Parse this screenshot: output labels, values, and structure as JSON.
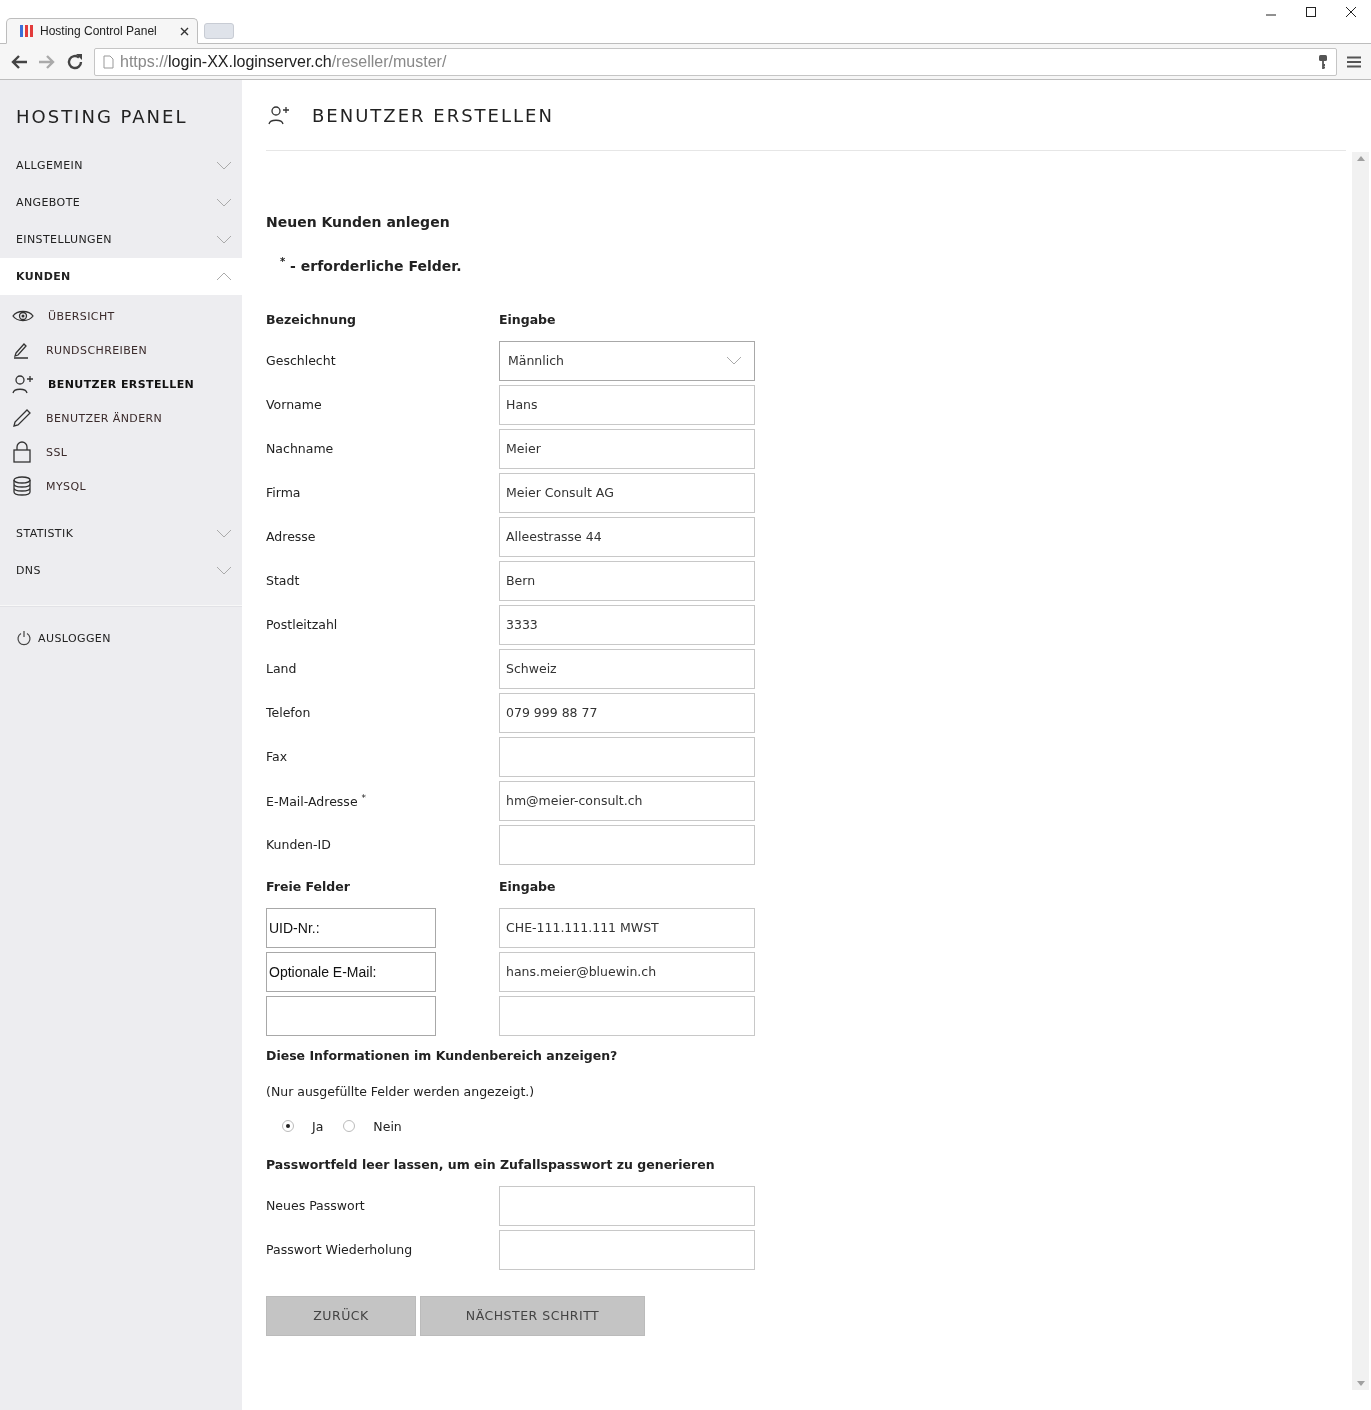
{
  "browser": {
    "tab_title": "Hosting Control Panel",
    "url": {
      "scheme": "https://",
      "host": "login-XX.loginserver.ch",
      "path": "/reseller/muster/"
    }
  },
  "sidebar": {
    "title": "HOSTING PANEL",
    "sections": [
      {
        "label": "ALLGEMEIN",
        "expanded": false
      },
      {
        "label": "ANGEBOTE",
        "expanded": false
      },
      {
        "label": "EINSTELLUNGEN",
        "expanded": false
      },
      {
        "label": "KUNDEN",
        "expanded": true,
        "children": [
          {
            "label": "ÜBERSICHT",
            "selected": false
          },
          {
            "label": "RUNDSCHREIBEN",
            "selected": false
          },
          {
            "label": "BENUTZER ERSTELLEN",
            "selected": true
          },
          {
            "label": "BENUTZER ÄNDERN",
            "selected": false
          },
          {
            "label": "SSL",
            "selected": false
          },
          {
            "label": "MYSQL",
            "selected": false
          }
        ]
      },
      {
        "label": "STATISTIK",
        "expanded": false
      },
      {
        "label": "DNS",
        "expanded": false
      }
    ],
    "logout": "AUSLOGGEN"
  },
  "page": {
    "title": "BENUTZER ERSTELLEN"
  },
  "form": {
    "heading": "Neuen Kunden anlegen",
    "required_note": "$^{*}$ - erforderliche Felder.",
    "columns": [
      "Bezeichnung",
      "Eingabe"
    ],
    "fields": [
      {
        "label": "Geschlecht",
        "value": "Männlich",
        "kind": "select"
      },
      {
        "label": "Vorname",
        "value": "Hans",
        "kind": "text"
      },
      {
        "label": "Nachname",
        "value": "Meier",
        "kind": "text"
      },
      {
        "label": "Firma",
        "value": "Meier Consult AG",
        "kind": "text"
      },
      {
        "label": "Adresse",
        "value": "Alleestrasse 44",
        "kind": "text"
      },
      {
        "label": "Stadt",
        "value": "Bern",
        "kind": "text"
      },
      {
        "label": "Postleitzahl",
        "value": "3333",
        "kind": "text"
      },
      {
        "label": "Land",
        "value": "Schweiz",
        "kind": "text"
      },
      {
        "label": "Telefon",
        "value": "079 999 88 77",
        "kind": "text"
      },
      {
        "label": "Fax",
        "kind": "text"
      },
      {
        "label": "E-Mail-Adresse $^{*}$",
        "value": "hm@meier-consult.ch",
        "kind": "text"
      },
      {
        "label": "Kunden-ID",
        "kind": "text"
      }
    ],
    "free_columns": [
      "Freie Felder",
      "Eingabe"
    ],
    "free_fields": [
      {
        "kind": "filled",
        "name": "UID-Nr.:",
        "value": "CHE-111.111.111 MWST"
      },
      {
        "kind": "filled",
        "name": "Optionale E-Mail:",
        "value": "hans.meier@bluewin.ch"
      },
      {
        "kind": "blank"
      }
    ],
    "show_question": "Diese Informationen im Kundenbereich anzeigen?",
    "show_note": "(Nur ausgefüllte Felder werden angezeigt.)",
    "show_options": [
      {
        "label": "Ja",
        "selected": true
      },
      {
        "label": "Nein",
        "selected": false
      }
    ],
    "password_hint": "Passwortfeld leer lassen, um ein Zufallspasswort zu generieren",
    "password_fields": [
      {
        "label": "Neues Passwort"
      },
      {
        "label": "Passwort Wiederholung"
      }
    ],
    "buttons": [
      "ZURÜCK",
      "NÄCHSTER SCHRITT"
    ]
  }
}
